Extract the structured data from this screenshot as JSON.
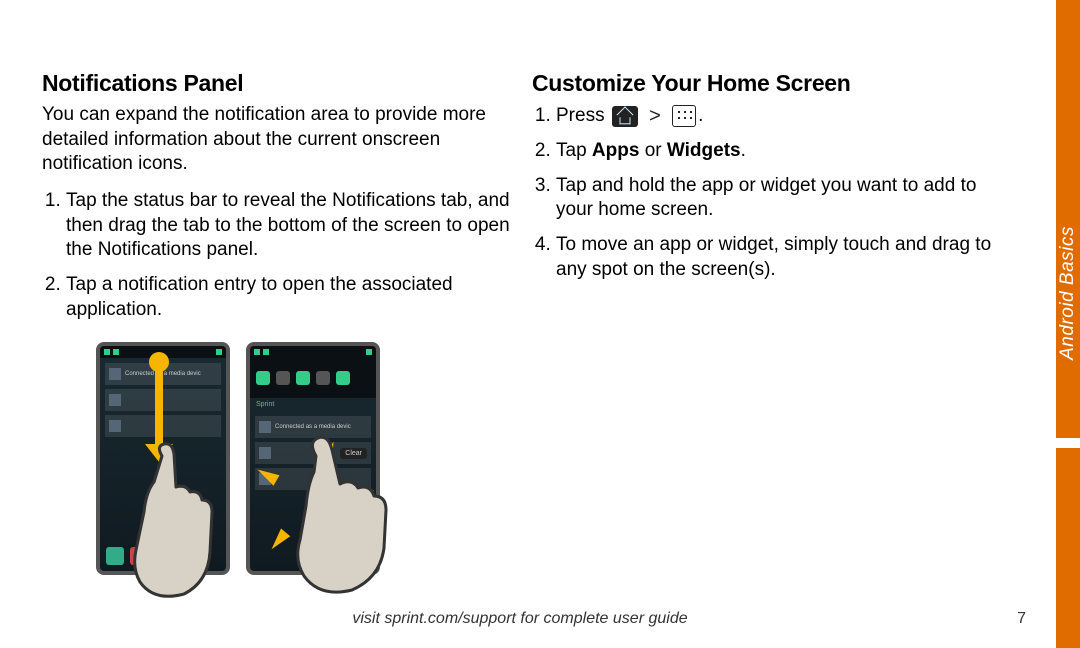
{
  "side_tab_label": "Android Basics",
  "left": {
    "heading": "Notifications Panel",
    "intro": "You can expand the notification area to provide more detailed information about the current onscreen notification icons.",
    "steps": [
      "Tap the status bar to reveal the Notifications tab, and then drag the tab to the bottom of the screen to open the Notifications panel.",
      "Tap a notification entry to open the associated application."
    ]
  },
  "right": {
    "heading": "Customize Your Home Screen",
    "step1_press": "Press",
    "step2_pre": "Tap ",
    "step2_b1": "Apps",
    "step2_mid": " or ",
    "step2_b2": "Widgets",
    "step2_post": ".",
    "step3": "Tap and hold the app or widget you want to add to your home screen.",
    "step4": "To move an app or widget, simply touch and drag to any spot on the screen(s)."
  },
  "icons": {
    "home": "home-icon",
    "greater_than": ">",
    "apps_grid": "apps-grid-icon"
  },
  "footer": "visit sprint.com/support for complete user guide",
  "page_number": "7",
  "illustration": {
    "phone1_notif": "Connected as a media devic",
    "phone2_notif": "Connected as a media devic",
    "clear_label": "Clear",
    "sprint_label": "Sprint"
  }
}
